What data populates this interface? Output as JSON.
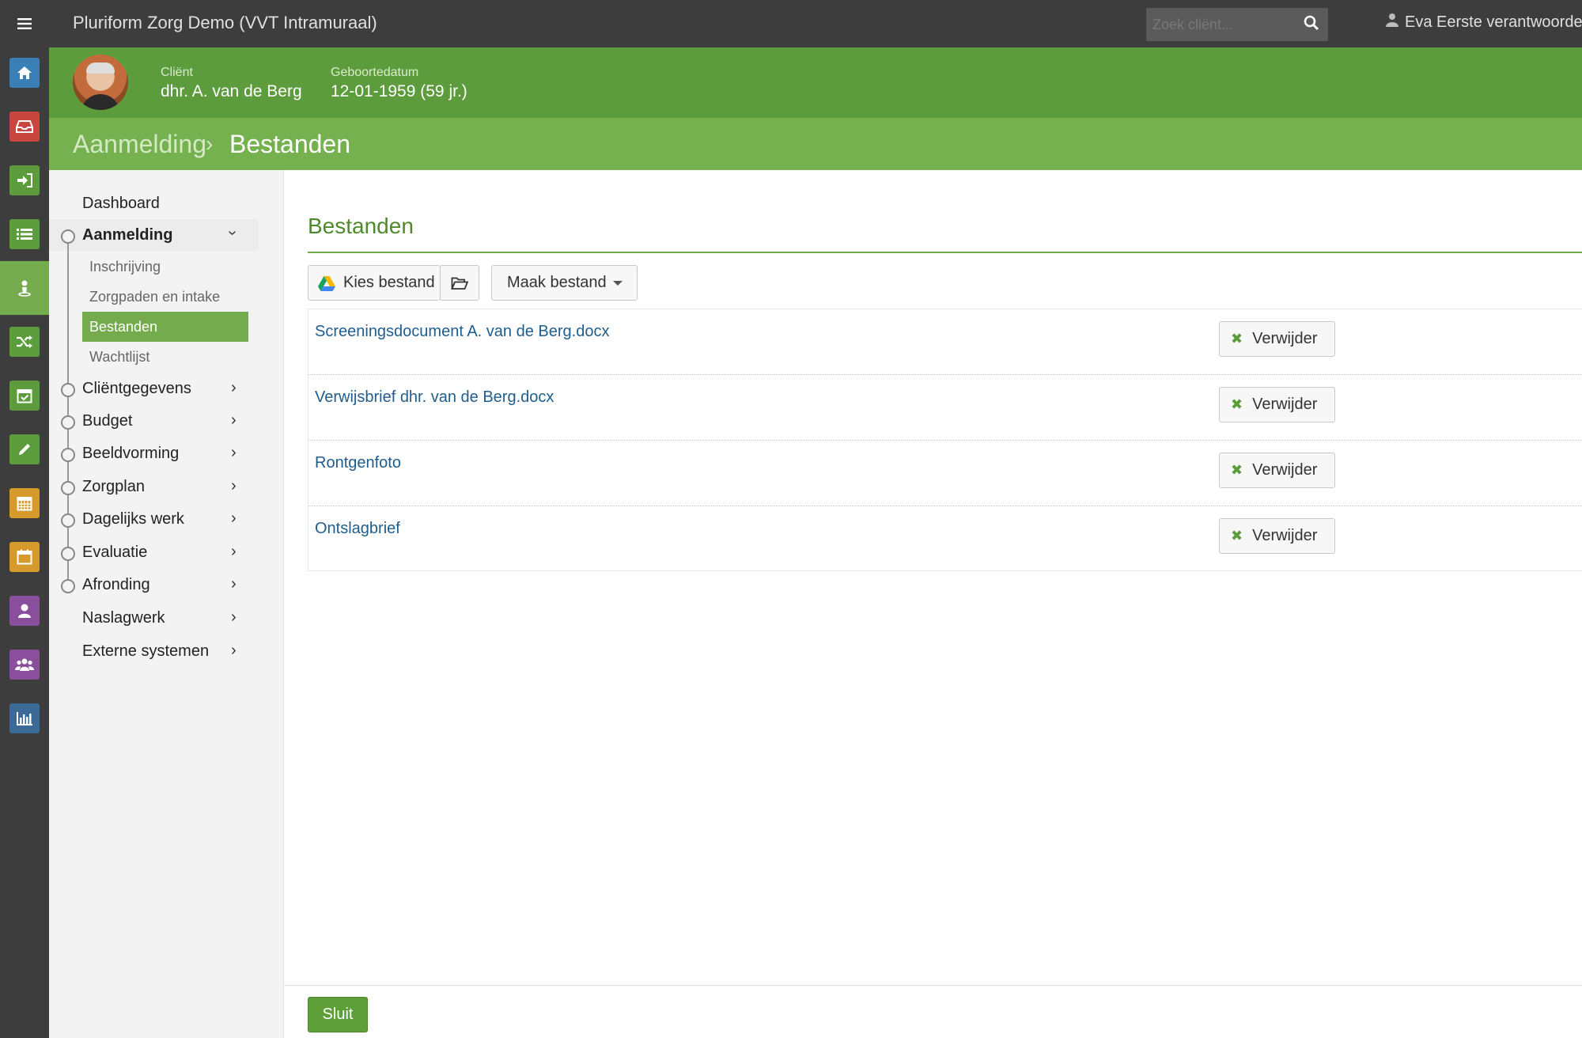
{
  "topbar": {
    "app_title": "Pluriform Zorg Demo  (VVT Intramuraal)",
    "search_placeholder": "Zoek cliënt...",
    "user_name": "Eva Eerste verantwoordelijke"
  },
  "rail": {
    "items": [
      {
        "icon": "home-icon",
        "color": "#3a7fb6"
      },
      {
        "icon": "inbox-icon",
        "color": "#c9453f"
      },
      {
        "icon": "sign-in-icon",
        "color": "#5d9c3c"
      },
      {
        "icon": "list-icon",
        "color": "#5d9c3c"
      },
      {
        "icon": "client-icon",
        "color": "#74ab4d"
      },
      {
        "icon": "shuffle-icon",
        "color": "#5d9c3c"
      },
      {
        "icon": "calendar-check-icon",
        "color": "#5d9c3c"
      },
      {
        "icon": "pencil-icon",
        "color": "#5d9c3c"
      },
      {
        "icon": "calendar-grid-icon",
        "color": "#d59a2b"
      },
      {
        "icon": "calendar-icon",
        "color": "#d59a2b"
      },
      {
        "icon": "user-icon",
        "color": "#8a4f9c"
      },
      {
        "icon": "group-icon",
        "color": "#8a4f9c"
      },
      {
        "icon": "bar-chart-icon",
        "color": "#3b6a96"
      }
    ]
  },
  "client": {
    "name_label": "Cliënt",
    "name": "dhr. A. van de Berg",
    "dob_label": "Geboortedatum",
    "dob": "12-01-1959 (59 jr.)"
  },
  "breadcrumb": {
    "parent": "Aanmelding",
    "separator": "›",
    "current": "Bestanden"
  },
  "sidenav": {
    "dashboard": "Dashboard",
    "aanmelding": "Aanmelding",
    "sub": [
      "Inschrijving",
      "Zorgpaden en intake",
      "Bestanden",
      "Wachtlijst"
    ],
    "sections": [
      "Cliëntgegevens",
      "Budget",
      "Beeldvorming",
      "Zorgplan",
      "Dagelijks werk",
      "Evaluatie",
      "Afronding"
    ],
    "naslagwerk": "Naslagwerk",
    "extern": "Externe systemen"
  },
  "main": {
    "heading": "Bestanden",
    "choose_file": "Kies bestand",
    "make_file": "Maak bestand",
    "delete_label": "Verwijder",
    "files": [
      "Screeningsdocument A. van de Berg.docx",
      "Verwijsbrief dhr. van de Berg.docx",
      "Rontgenfoto",
      "Ontslagbrief"
    ],
    "close": "Sluit"
  },
  "colors": {
    "green_dark": "#5d9c3c",
    "green_light": "#76b14f",
    "link_blue": "#1f5d8c",
    "topbar": "#3d3d3d"
  }
}
